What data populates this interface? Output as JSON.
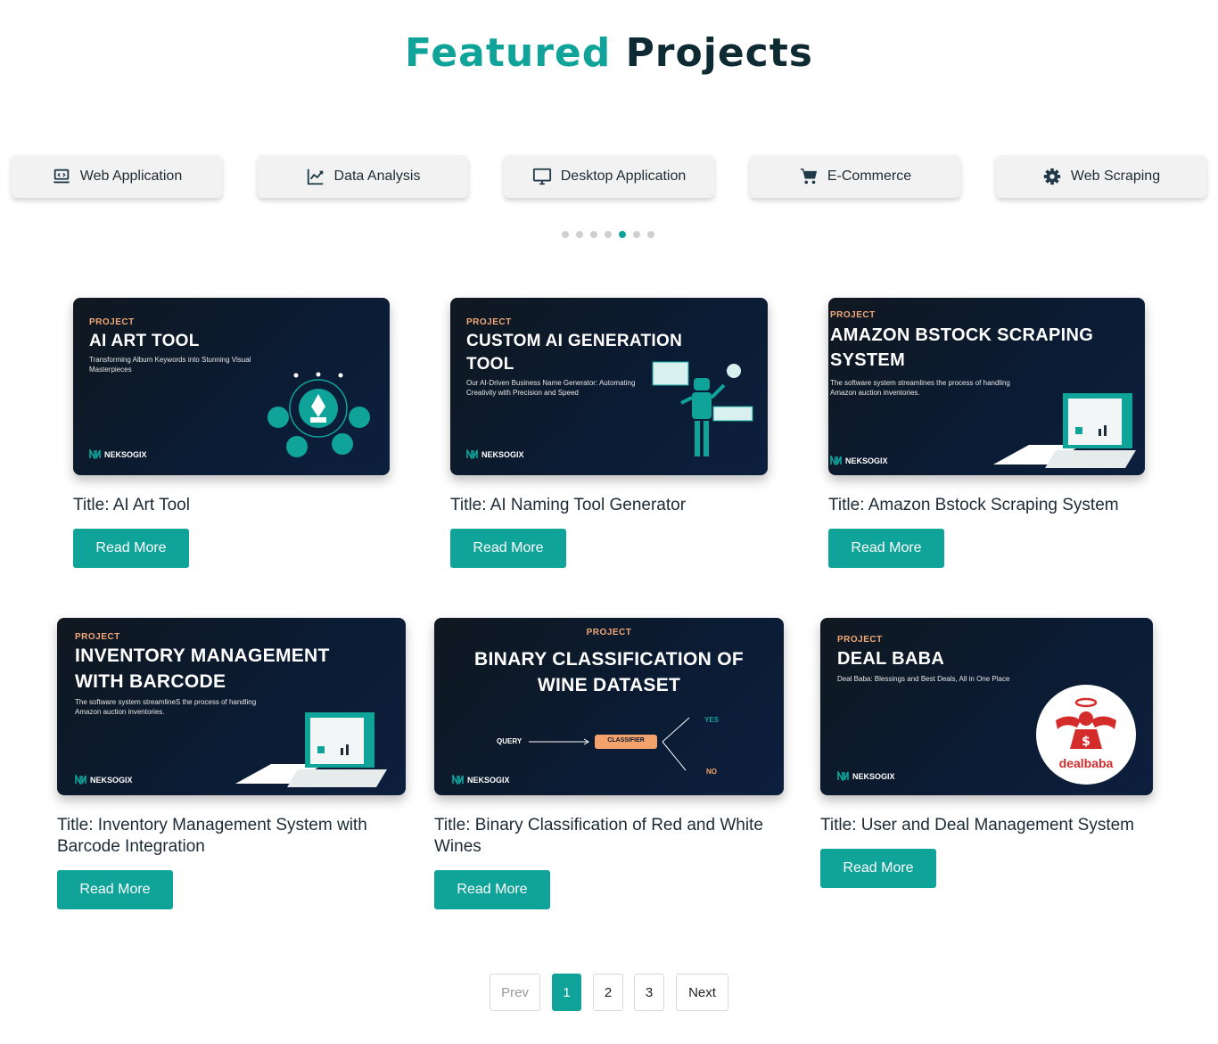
{
  "heading": {
    "accent": "Featured",
    "rest": "Projects"
  },
  "categories": [
    {
      "label": "Web Application",
      "icon": "laptop-code-icon"
    },
    {
      "label": "Data Analysis",
      "icon": "chart-line-icon"
    },
    {
      "label": "Desktop Application",
      "icon": "desktop-icon"
    },
    {
      "label": "E-Commerce",
      "icon": "shopping-cart-icon"
    },
    {
      "label": "Web Scraping",
      "icon": "gear-icon"
    }
  ],
  "carousel": {
    "dot_count": 7,
    "active_dot": 5
  },
  "brand": "NEKSOGIX",
  "projects": [
    {
      "tag": "PROJECT",
      "thumb_title": "AI ART TOOL",
      "thumb_subtitle": "Transforming Album Keywords into Stunning Visual Masterpieces",
      "title": "Title: AI Art Tool",
      "button": "Read More"
    },
    {
      "tag": "PROJECT",
      "thumb_title": "CUSTOM AI GENERATION TOOL",
      "thumb_subtitle": "Our AI-Driven Business Name Generator: Automating Creativity with Precision and Speed",
      "title": "Title: AI Naming Tool Generator",
      "button": "Read More"
    },
    {
      "tag": "PROJECT",
      "thumb_title": "AMAZON BSTOCK SCRAPING SYSTEM",
      "thumb_subtitle": "The software system streamlines the process of handling Amazon auction inventories.",
      "title": "Title: Amazon Bstock Scraping System",
      "button": "Read More"
    },
    {
      "tag": "PROJECT",
      "thumb_title": "INVENTORY MANAGEMENT WITH BARCODE",
      "thumb_subtitle": "The software system streamlineS the process of handling Amazon auction inventories.",
      "title": "Title: Inventory Management System with Barcode Integration",
      "button": "Read More"
    },
    {
      "tag": "PROJECT",
      "thumb_title": "BINARY CLASSIFICATION OF WINE DATASET",
      "thumb_subtitle": "",
      "title": "Title: Binary Classification of Red and White Wines",
      "button": "Read More",
      "diagram": {
        "query": "QUERY",
        "classifier": "CLASSIFIER",
        "yes": "YES",
        "no": "NO"
      }
    },
    {
      "tag": "PROJECT",
      "thumb_title": "DEAL BABA",
      "thumb_subtitle": "Deal Baba: Blessings and Best Deals, All in One Place",
      "title": "Title: User and Deal Management System",
      "button": "Read More",
      "badge_text": "dealbaba"
    }
  ],
  "pagination": {
    "prev": "Prev",
    "pages": [
      "1",
      "2",
      "3"
    ],
    "current": "1",
    "next": "Next"
  },
  "colors": {
    "accent": "#0fa39a",
    "dark": "#0e2a33",
    "thumb_bg": "#0b1b33",
    "tag": "#f0a878"
  }
}
